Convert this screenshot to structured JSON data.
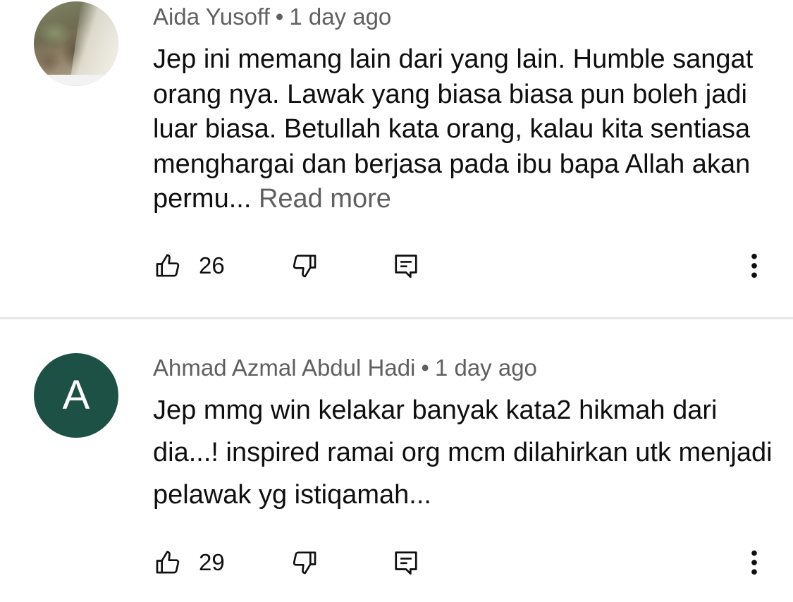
{
  "comments": [
    {
      "author": "Aida Yusoff",
      "separator": "•",
      "time": "1 day ago",
      "avatar": "photo-avatar",
      "text": "Jep ini memang lain dari yang lain. Humble sangat orang nya. Lawak yang biasa biasa pun boleh jadi luar biasa. Betullah kata orang, kalau kita sentiasa menghargai dan berjasa pada ibu bapa Allah akan permu...",
      "read_more": "Read more",
      "likes": "26"
    },
    {
      "author": "Ahmad Azmal Abdul Hadi",
      "separator": "•",
      "time": "1 day ago",
      "avatar_letter": "A",
      "avatar_color": "#1e5145",
      "text": "Jep mmg win kelakar banyak kata2 hikmah dari dia...! inspired ramai org mcm dilahirkan utk menjadi pelawak yg istiqamah...",
      "likes": "29"
    }
  ],
  "icons": {
    "like": "thumbs-up-icon",
    "dislike": "thumbs-down-icon",
    "reply": "reply-icon",
    "more": "more-vert-icon"
  }
}
